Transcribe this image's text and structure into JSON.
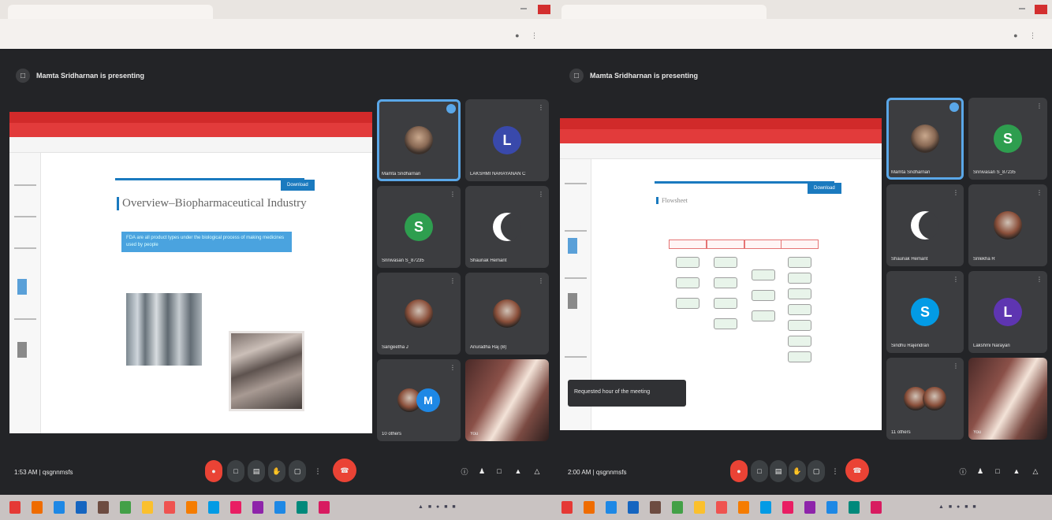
{
  "left_window": {
    "presenter": "Mamta Sridharnan is presenting",
    "clock": "1:53 AM | qsgnnmsfs",
    "slide_title": "Overview–Biopharmaceutical Industry",
    "slide_badge": "Download",
    "slide_highlight": "FDA are all product types under the biological process of making medicines used by people",
    "tiles": [
      {
        "name": "Mamta Sridharnan",
        "initial": "",
        "style": "photo-face",
        "color": "",
        "active": true
      },
      {
        "name": "LAKSHMI NARAYANAN C",
        "initial": "L",
        "style": "letter",
        "color": "#3949ab",
        "active": false
      },
      {
        "name": "Srinivasan S_87235",
        "initial": "S",
        "style": "letter",
        "color": "#2e9e4f",
        "active": false
      },
      {
        "name": "Shaunak Hemant",
        "initial": "",
        "style": "crescent",
        "color": "",
        "active": false
      },
      {
        "name": "Sangeetha J",
        "initial": "",
        "style": "dark-face",
        "color": "",
        "active": false
      },
      {
        "name": "Anuradha Raj (B)",
        "initial": "",
        "style": "dark-face",
        "color": "",
        "active": false
      },
      {
        "name": "10 others",
        "initial": "M",
        "style": "letter",
        "color": "#1e88e5",
        "active": false
      },
      {
        "name": "You",
        "initial": "",
        "style": "room",
        "color": "",
        "active": false
      }
    ]
  },
  "right_window": {
    "presenter": "Mamta Sridharnan is presenting",
    "clock": "2:00 AM | qsgnnmsfs",
    "slide_title": "Flowsheet",
    "slide_badge": "Download",
    "caption": "Requested hour of the meeting",
    "tiles": [
      {
        "name": "Mamta Sridharnan",
        "initial": "",
        "style": "photo-face",
        "color": "",
        "active": true
      },
      {
        "name": "Srinivasan S_87235",
        "initial": "S",
        "style": "letter",
        "color": "#2e9e4f",
        "active": false
      },
      {
        "name": "Shaunak Hemant",
        "initial": "",
        "style": "crescent",
        "color": "",
        "active": false
      },
      {
        "name": "Srilekha R",
        "initial": "",
        "style": "dark-face",
        "color": "",
        "active": false
      },
      {
        "name": "Sindhu Rajendran",
        "initial": "S",
        "style": "letter",
        "color": "#039be5",
        "active": false
      },
      {
        "name": "Lakshmi Narayan",
        "initial": "L",
        "style": "letter",
        "color": "#5e35b1",
        "active": false
      },
      {
        "name": "11 others",
        "initial": "",
        "style": "dark-face",
        "color": "",
        "active": false
      },
      {
        "name": "You",
        "initial": "",
        "style": "room",
        "color": "",
        "active": false
      }
    ]
  },
  "colors": {
    "meet_bg": "#232427",
    "accent_red": "#ea4335",
    "ppt_red": "#d12a2a",
    "active_outline": "#5aa7e8"
  }
}
